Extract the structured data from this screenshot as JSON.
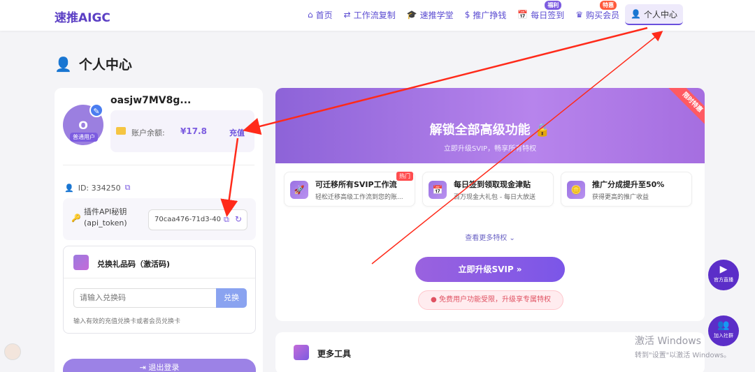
{
  "app": {
    "logo": "速推AIGC"
  },
  "nav": {
    "items": [
      {
        "icon": "⌂",
        "label": "首页"
      },
      {
        "icon": "⇄",
        "label": "工作流复制"
      },
      {
        "icon": "🎓",
        "label": "速推学堂"
      },
      {
        "icon": "$",
        "label": "推广挣钱"
      },
      {
        "icon": "📅",
        "label": "每日签到",
        "badge": "福利"
      },
      {
        "icon": "♛",
        "label": "购买会员",
        "badge": "特惠"
      },
      {
        "icon": "👤",
        "label": "个人中心"
      }
    ]
  },
  "page": {
    "title": "个人中心"
  },
  "profile": {
    "avatar_letter": "O",
    "user_tag": "普通用户",
    "username": "oasjw7MV8g...",
    "balance_label": "账户余额:",
    "balance_value": "¥17.8",
    "recharge_label": "充值",
    "id_text": "ID: 334250",
    "api_label_line1": "插件API秘钥",
    "api_label_line2": "(api_token)",
    "api_token": "70caa476-71d3-40",
    "redeem_title": "兑换礼品码（激活码)",
    "redeem_placeholder": "请输入兑换码",
    "redeem_button": "兑换",
    "redeem_hint": "输入有效的充值兑换卡或者会员兑换卡",
    "logout_label": "⇥ 退出登录"
  },
  "promo": {
    "title": "解锁全部高级功能 🔒",
    "subtitle": "立即升级SVIP，畅享所有特权",
    "ribbon": "限时特惠",
    "features": [
      {
        "title": "可迁移所有SVIP工作流",
        "desc": "轻松迁移高级工作流到您的账...",
        "hot": "热门",
        "icon": "🚀"
      },
      {
        "title": "每日签到领取现金津贴",
        "desc": "百万现金大礼包 - 每日大放送",
        "hot": "",
        "icon": "📅"
      },
      {
        "title": "推广分成提升至50%",
        "desc": "获得更高的推广收益",
        "hot": "",
        "icon": "🪙"
      }
    ],
    "more_label": "查看更多特权 ⌄",
    "upgrade_label": "立即升级SVIP »",
    "limit_note": "● 免费用户功能受限，升级享专属特权"
  },
  "tools": {
    "title": "更多工具"
  },
  "floating": {
    "live_label": "官方直播",
    "community_label": "加入社群"
  },
  "watermark": {
    "line1": "激活 Windows",
    "line2": "转到\"设置\"以激活 Windows。"
  },
  "colors": {
    "accent": "#7c5ce0",
    "annotation_arrow": "#ff2a1a"
  }
}
